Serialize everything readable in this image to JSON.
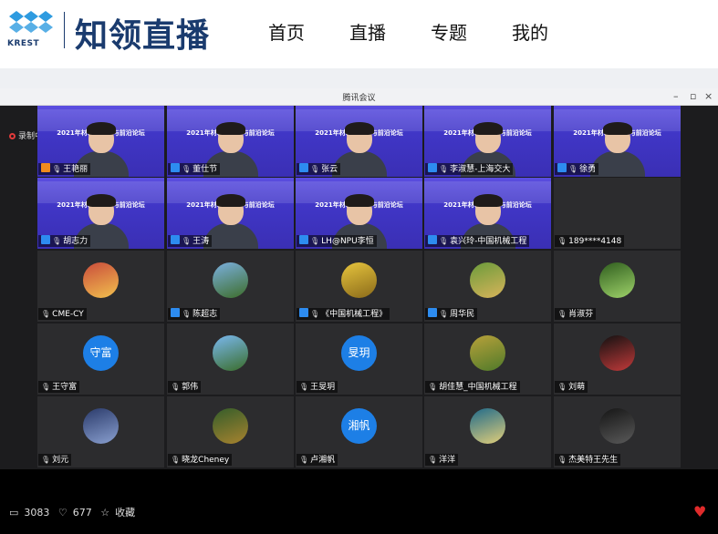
{
  "header": {
    "brand": "知领直播",
    "logo_sub": "KREST",
    "nav": [
      "首页",
      "直播",
      "专题",
      "我的"
    ]
  },
  "meeting": {
    "window_title": "腾讯会议",
    "recording_label": "录制中",
    "slide_banner": "2021年材料数字化与前沿论坛",
    "tiles": [
      {
        "name": "王艳丽",
        "kind": "slide"
      },
      {
        "name": "董仕节",
        "kind": "slide"
      },
      {
        "name": "张云",
        "kind": "slide"
      },
      {
        "name": "李淑慧-上海交大",
        "kind": "slide"
      },
      {
        "name": "徐勇",
        "kind": "slide"
      },
      {
        "name": "胡志力",
        "kind": "slide"
      },
      {
        "name": "王涛",
        "kind": "slide"
      },
      {
        "name": "LH@NPU李恒",
        "kind": "slide"
      },
      {
        "name": "袁兴玲-中国机械工程",
        "kind": "slide"
      },
      {
        "name": "189****4148",
        "kind": "dark"
      },
      {
        "name": "CME-CY",
        "kind": "avatar"
      },
      {
        "name": "陈超志",
        "kind": "avatar"
      },
      {
        "name": "《中国机械工程》",
        "kind": "avatar"
      },
      {
        "name": "周华民",
        "kind": "avatar"
      },
      {
        "name": "肖淑芬",
        "kind": "avatar"
      },
      {
        "name": "王守富",
        "kind": "initial",
        "initial": "守富"
      },
      {
        "name": "郭伟",
        "kind": "avatar"
      },
      {
        "name": "王旻玥",
        "kind": "initial",
        "initial": "旻玥"
      },
      {
        "name": "胡佳慧_中国机械工程",
        "kind": "avatar"
      },
      {
        "name": "刘萌",
        "kind": "avatar"
      },
      {
        "name": "刘元",
        "kind": "avatar"
      },
      {
        "name": "晓龙Cheney",
        "kind": "avatar"
      },
      {
        "name": "卢湘帆",
        "kind": "initial",
        "initial": "湘帆"
      },
      {
        "name": "洋洋",
        "kind": "avatar"
      },
      {
        "name": "杰美特王先生",
        "kind": "avatar"
      }
    ]
  },
  "footer": {
    "viewers": "3083",
    "likes": "677",
    "favorite_label": "收藏"
  },
  "colors": {
    "brand": "#1a3b6e",
    "slide": "#4a3fd0",
    "initial_avatar": "#1d7fe6",
    "like_heart": "#e02b2b"
  }
}
